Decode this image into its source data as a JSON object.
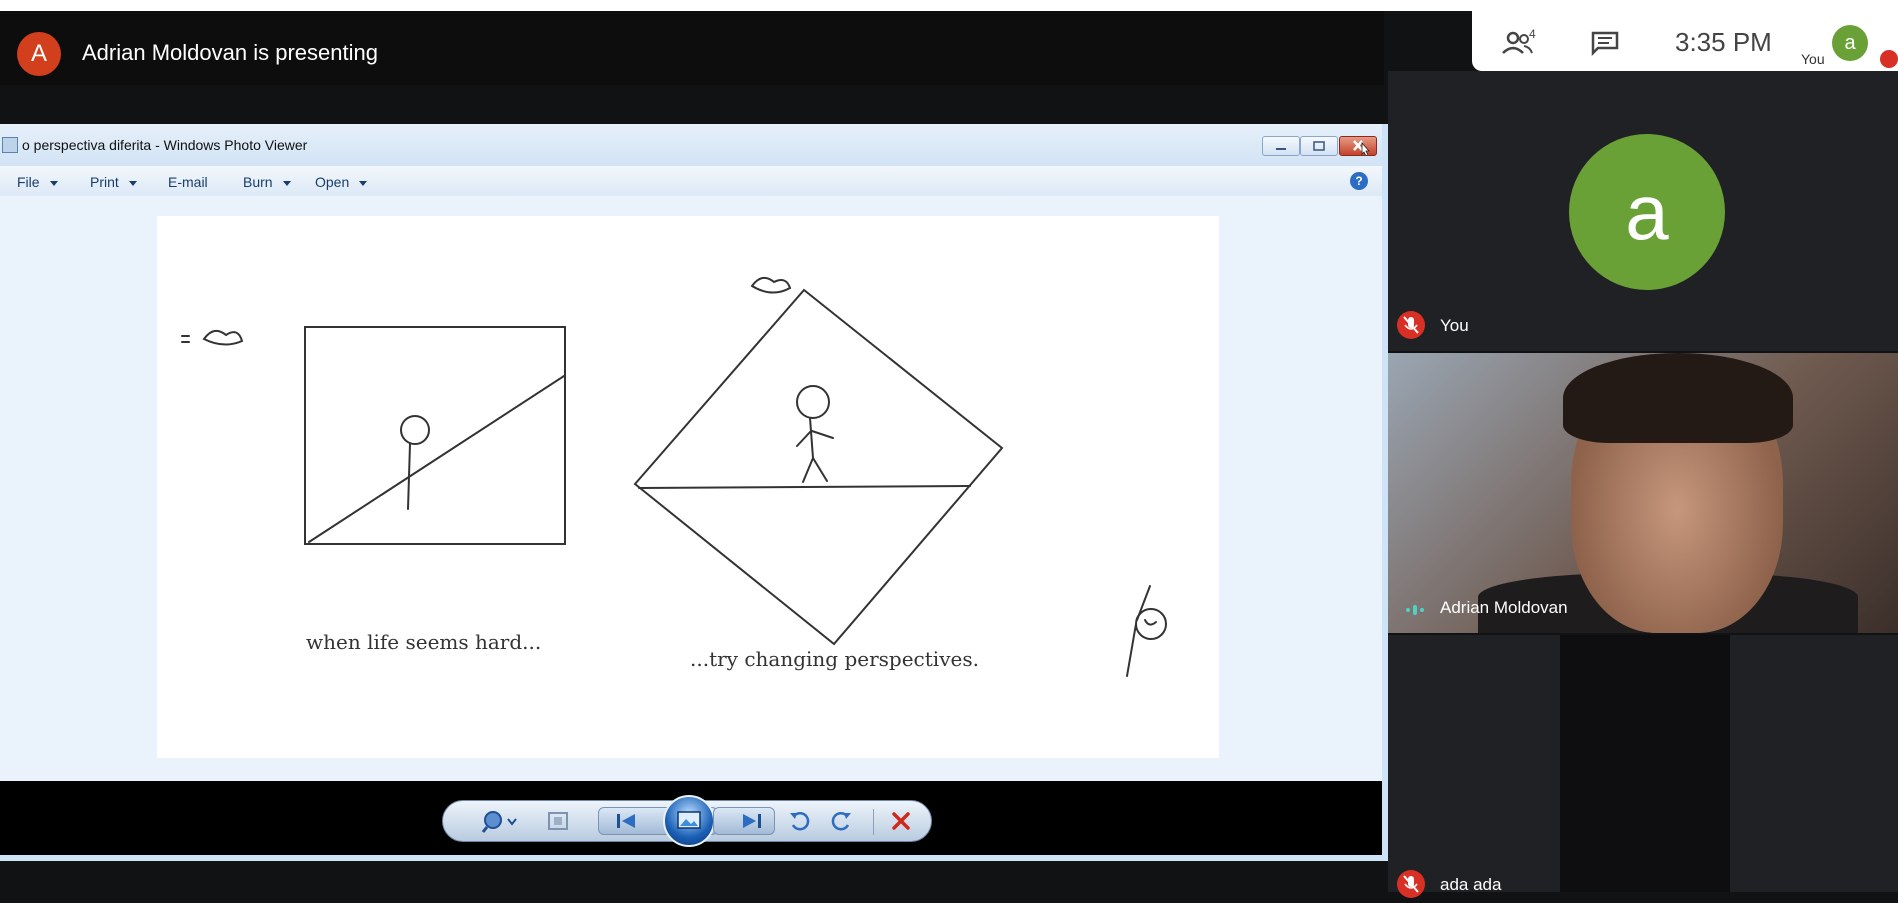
{
  "presenter": {
    "initial": "A",
    "text": "Adrian Moldovan is presenting"
  },
  "header": {
    "participants_count": "4",
    "time": "3:35 PM",
    "you_label": "You",
    "you_initial": "a"
  },
  "photo_viewer": {
    "title": "o perspectiva diferita - Windows Photo Viewer",
    "menu": [
      "File",
      "Print",
      "E-mail",
      "Burn",
      "Open"
    ],
    "help": "?",
    "image": {
      "caption_left": "when life seems hard...",
      "caption_right": "...try changing perspectives."
    }
  },
  "tiles": [
    {
      "name": "You",
      "initial": "a",
      "muted": true
    },
    {
      "name": "Adrian Moldovan",
      "speaking": true
    },
    {
      "name": "ada ada",
      "muted": true
    }
  ]
}
